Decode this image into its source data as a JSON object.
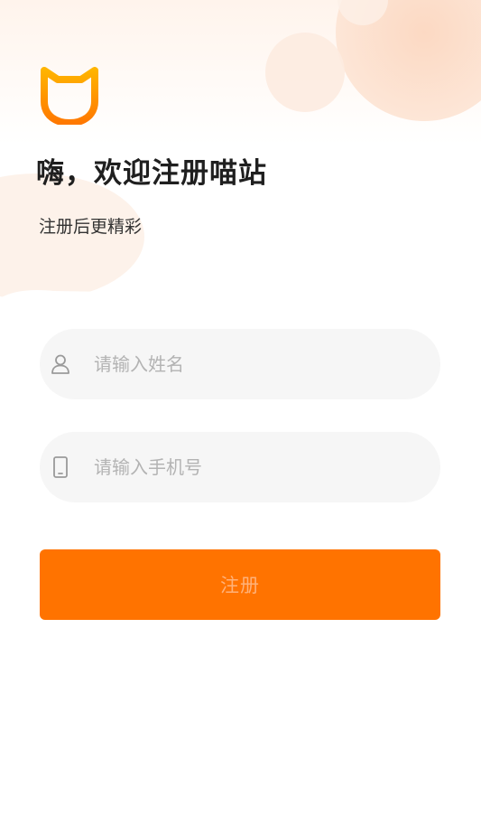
{
  "header": {
    "logo_icon": "cat-face-icon",
    "title": "嗨，欢迎注册喵站",
    "subtitle": "注册后更精彩"
  },
  "form": {
    "name_field": {
      "icon": "user-icon",
      "value": "",
      "placeholder": "请输入姓名"
    },
    "phone_field": {
      "icon": "phone-icon",
      "value": "",
      "placeholder": "请输入手机号"
    },
    "submit_label": "注册"
  },
  "colors": {
    "accent": "#ff7300",
    "button_text": "#ffb27a",
    "logo_gradient": [
      "#ffb400",
      "#ff7800"
    ],
    "background_blob": "#fde3d2",
    "input_background": "#f6f6f6",
    "placeholder": "#b3b3b3"
  }
}
